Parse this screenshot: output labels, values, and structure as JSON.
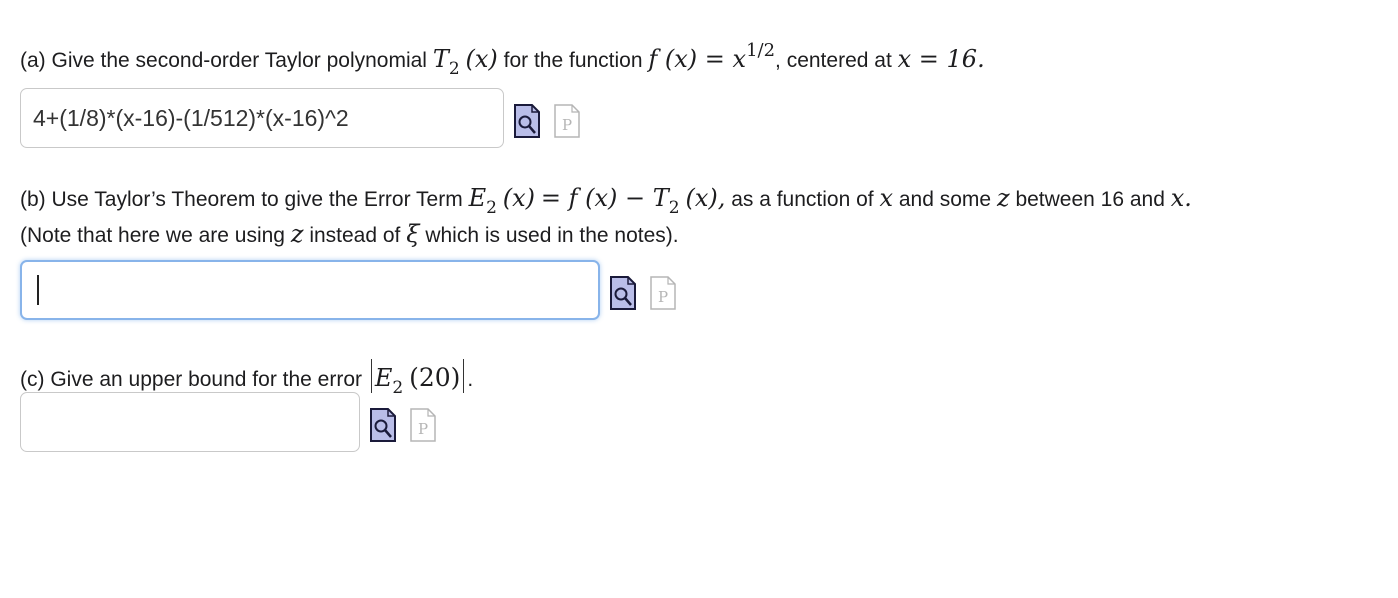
{
  "part_a": {
    "prefix": "(a) Give the second-order Taylor polynomial",
    "T_symbol": "T",
    "T_sub": "2",
    "arg_x": "(x)",
    "mid_text": "for the function",
    "f_expr": "f (x) = x",
    "exponent": "1/2",
    "centered_text": ", centered at",
    "center_expr": "x = 16.",
    "answer_value": "4+(1/8)*(x-16)-(1/512)*(x-16)^2"
  },
  "part_b": {
    "prefix": "(b) Use Taylor’s Theorem to give the Error Term",
    "E_symbol": "E",
    "E_sub": "2",
    "arg_x": "(x)",
    "eq_expr": "= f (x) − T",
    "T_sub": "2",
    "arg_x2": "(x),",
    "middle_text": "as a function of",
    "x_var": "x",
    "and_text": "and some",
    "z_var": "z",
    "between_text": "between 16 and",
    "end_x": "x.",
    "note_prefix": "(Note that here we are using",
    "note_z": "z",
    "note_mid": "instead of",
    "note_xi": "ξ",
    "note_suffix": "which is used in the notes).",
    "answer_value": ""
  },
  "part_c": {
    "prefix": "(c) Give an upper bound for the error",
    "E_symbol": "E",
    "E_sub": "2",
    "arg": "(20)",
    "end": ".",
    "answer_value": ""
  },
  "icons": {
    "preview": "preview-magnifier-icon",
    "equation_editor": "equation-editor-page-icon"
  },
  "colors": {
    "preview_icon_fill": "#b9bde8",
    "focus_border": "#88b4ea",
    "field_border": "#c9c9c9"
  }
}
